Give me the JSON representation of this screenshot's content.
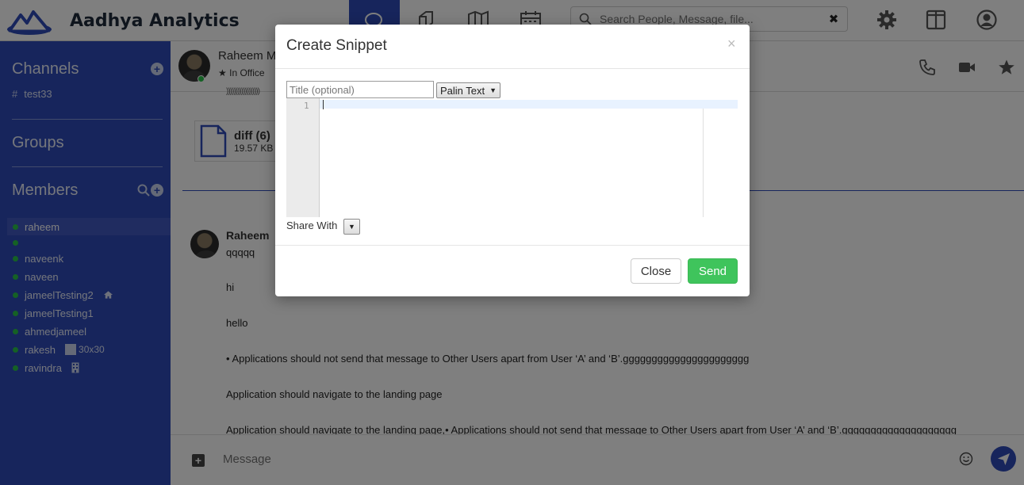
{
  "brand": {
    "name": "Aadhya Analytics"
  },
  "topnav": {
    "tabs": [
      {
        "icon": "chat-bubbles-icon",
        "active": true
      },
      {
        "icon": "documents-icon",
        "active": false
      },
      {
        "icon": "map-icon",
        "active": false
      },
      {
        "icon": "calendar-icon",
        "active": false
      }
    ],
    "search_placeholder": "Search People, Message, file...",
    "search_clear": "✖",
    "right_icons": [
      "gear-icon",
      "split-view-icon",
      "user-profile-icon"
    ]
  },
  "sidebar": {
    "channels_heading": "Channels",
    "channels": [
      {
        "name": "test33"
      }
    ],
    "groups_heading": "Groups",
    "members_heading": "Members",
    "members": [
      {
        "name": "raheem",
        "selected": true
      },
      {
        "name": "",
        "selected": false
      },
      {
        "name": "naveenk",
        "selected": false
      },
      {
        "name": "naveen",
        "selected": false
      },
      {
        "name": "jameelTesting2",
        "selected": false,
        "extra_icon": "home-icon"
      },
      {
        "name": "jameelTesting1",
        "selected": false
      },
      {
        "name": "ahmedjameel",
        "selected": false
      },
      {
        "name": "rakesh",
        "selected": false,
        "extra_text": "30x30"
      },
      {
        "name": "ravindra",
        "selected": false,
        "extra_icon": "building-icon"
      }
    ]
  },
  "chat": {
    "header": {
      "name": "Raheem M",
      "status": "In Office"
    },
    "partial_text": "))))))))))))))))))",
    "file": {
      "name": "diff (6)",
      "size": "19.57 KB"
    },
    "message": {
      "sender": "Raheem",
      "lines": [
        "qqqqq",
        "hi",
        "hello",
        "• Applications should not send that message to Other Users apart from User ‘A’ and ‘B’.gggggggggggggggggggggg",
        "Application should navigate to the landing page",
        "Application should navigate to the landing page,• Applications should not send that message to Other Users apart from User ‘A’ and ‘B’.gggggggggggggggggggg"
      ]
    },
    "composer": {
      "placeholder": "Message"
    }
  },
  "modal": {
    "title": "Create Snippet",
    "close_x": "×",
    "title_placeholder": "Title (optional)",
    "language": "Palin Text",
    "line_number": "1",
    "share_label": "Share With",
    "share_value": "",
    "close_label": "Close",
    "send_label": "Send"
  },
  "colors": {
    "brand_blue": "#2f4bb8",
    "online_green": "#2bc24a",
    "send_green": "#3fc45c"
  }
}
